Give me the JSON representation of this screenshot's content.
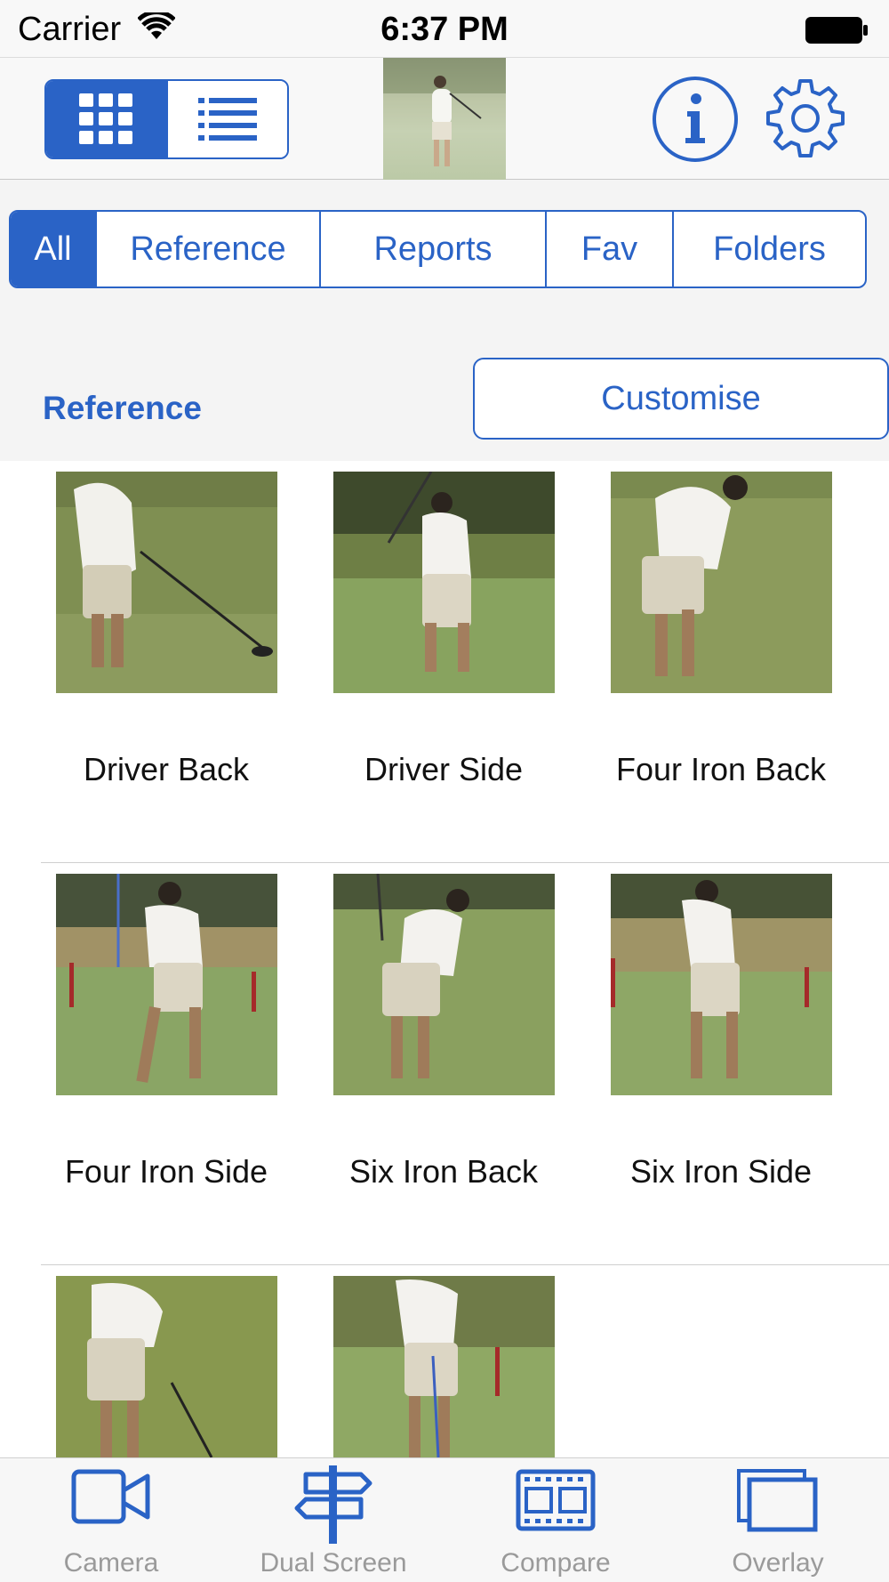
{
  "status_bar": {
    "carrier": "Carrier",
    "time": "6:37 PM"
  },
  "toolbar": {
    "view_modes": [
      "grid-view",
      "list-view"
    ],
    "active_view": "grid-view",
    "accent": "#2a63c6"
  },
  "filters": {
    "tabs": [
      "All",
      "Reference",
      "Reports",
      "Fav",
      "Folders"
    ],
    "active": "All"
  },
  "section": {
    "title": "Reference",
    "customise_label": "Customise"
  },
  "items": [
    {
      "label": "Driver Back"
    },
    {
      "label": "Driver Side"
    },
    {
      "label": "Four Iron Back"
    },
    {
      "label": "Four Iron Side"
    },
    {
      "label": "Six Iron Back"
    },
    {
      "label": "Six Iron Side"
    },
    {
      "label": ""
    },
    {
      "label": ""
    }
  ],
  "tab_bar": {
    "tabs": [
      {
        "label": "Camera",
        "icon": "video-camera-icon"
      },
      {
        "label": "Dual Screen",
        "icon": "signpost-icon"
      },
      {
        "label": "Compare",
        "icon": "film-frames-icon"
      },
      {
        "label": "Overlay",
        "icon": "overlay-windows-icon"
      }
    ]
  }
}
